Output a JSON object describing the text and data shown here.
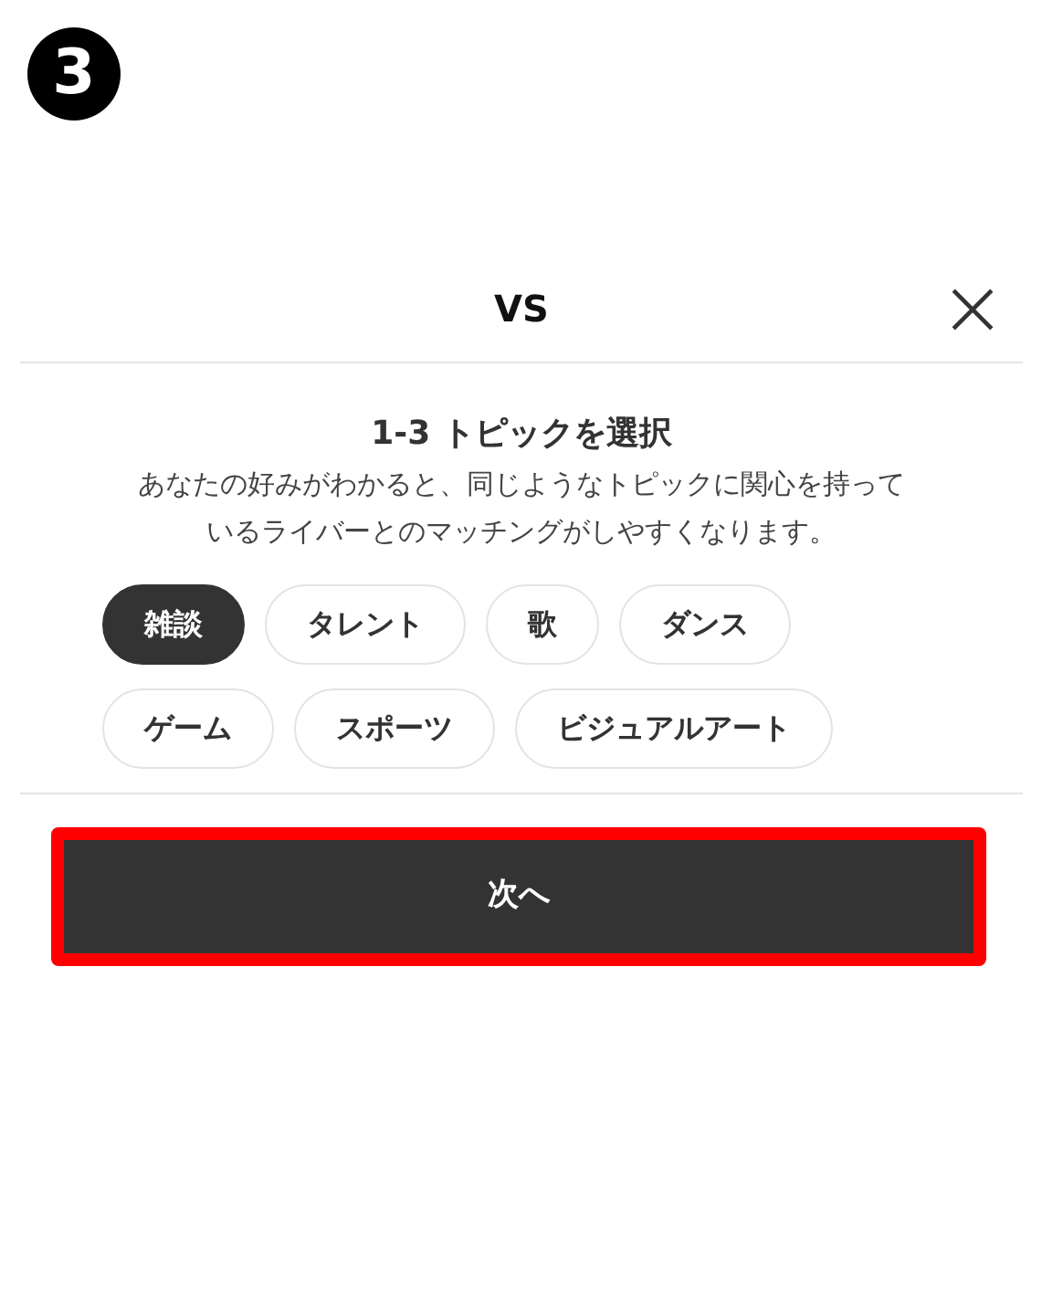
{
  "step_badge": "3",
  "dialog": {
    "title": "VS",
    "heading": "1-3 トピックを選択",
    "description": "あなたの好みがわかると、同じようなトピックに関心を持っているライバーとのマッチングがしやすくなります。",
    "topics": [
      {
        "label": "雑談",
        "selected": true
      },
      {
        "label": "タレント",
        "selected": false
      },
      {
        "label": "歌",
        "selected": false
      },
      {
        "label": "ダンス",
        "selected": false
      },
      {
        "label": "ゲーム",
        "selected": false
      },
      {
        "label": "スポーツ",
        "selected": false
      },
      {
        "label": "ビジュアルアート",
        "selected": false
      }
    ],
    "next_button": {
      "label": "次へ",
      "highlighted": true
    }
  }
}
